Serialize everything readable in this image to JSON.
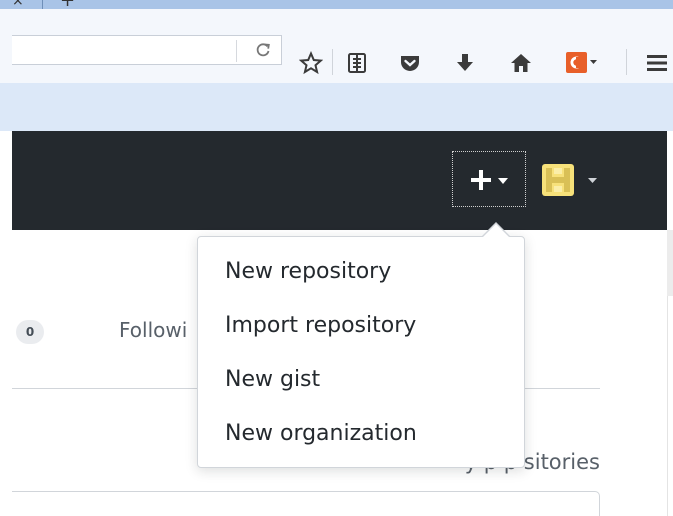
{
  "browser": {
    "tab_close_glyph": "×",
    "new_tab_glyph": "+",
    "toolbar_icons": [
      "star-icon",
      "reading-list-icon",
      "pocket-icon",
      "download-icon",
      "home-icon",
      "extension-icon",
      "menu-icon"
    ]
  },
  "header": {
    "create_button_icon": "plus-icon",
    "avatar_icon": "avatar-icon"
  },
  "dropdown": {
    "items": [
      {
        "label": "New repository"
      },
      {
        "label": "Import repository"
      },
      {
        "label": "New gist"
      },
      {
        "label": "New organization"
      }
    ]
  },
  "profile": {
    "counter": "0",
    "following_label": "Followi",
    "repositories_text": "y p          p sitories"
  },
  "colors": {
    "header_bg": "#24292e",
    "accent": "#f7e17a",
    "menu_text": "#24292e"
  }
}
